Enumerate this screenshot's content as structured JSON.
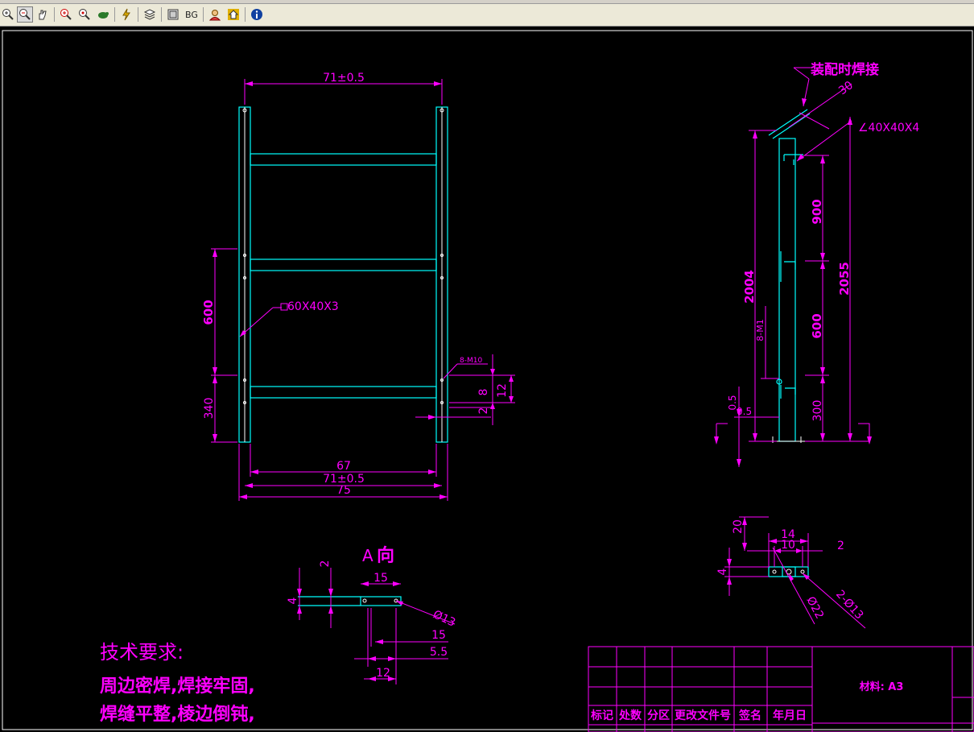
{
  "toolbar": {
    "buttons": [
      {
        "name": "zoom-in-icon",
        "glyph": "⊕"
      },
      {
        "name": "zoom-window-icon",
        "glyph": "🔍"
      },
      {
        "name": "pan-icon",
        "glyph": "✋"
      },
      {
        "name": "zoom-extents-icon",
        "glyph": "⊕"
      },
      {
        "name": "zoom-realtime-icon",
        "glyph": "🔍"
      },
      {
        "name": "orbit-icon",
        "glyph": "🐢"
      },
      {
        "name": "regen-icon",
        "glyph": "⚡"
      },
      {
        "name": "layers-icon",
        "glyph": "≣"
      },
      {
        "name": "layout-icon",
        "glyph": "▣"
      },
      {
        "name": "background-icon",
        "glyph": "BG"
      },
      {
        "name": "user-icon",
        "glyph": "☺"
      },
      {
        "name": "home-icon",
        "glyph": "⌂"
      },
      {
        "name": "info-icon",
        "glyph": "i"
      }
    ]
  },
  "drawing": {
    "front_view": {
      "top_width": "71±0.5",
      "tube_label": "60X40X3",
      "dim_600": "600",
      "dim_340": "340",
      "bolt_label": "8-M10",
      "dim_8": "8",
      "dim_12": "12",
      "dim_2": "2",
      "bottom_67": "67",
      "bottom_71": "71±0.5",
      "bottom_75": "75"
    },
    "side_view": {
      "weld_note": "装配时焊接",
      "angle_30": "30",
      "angle_label": "∠40X40X4",
      "dim_900": "900",
      "dim_2004": "2004",
      "dim_2055": "2055",
      "dim_600": "600",
      "dim_300": "300",
      "dim_8m1": "8-M1",
      "dim_05a": "0.5",
      "dim_05b": "0.5"
    },
    "view_a": {
      "title_a": "A",
      "title_dir": "向",
      "dim_2": "2",
      "dim_4": "4",
      "dim_15": "15",
      "dim_phi13": "Ø13",
      "dim_15b": "15",
      "dim_55": "5.5",
      "dim_12": "12"
    },
    "detail_view": {
      "dim_20": "20",
      "dim_14": "14",
      "dim_10": "10",
      "dim_2": "2",
      "dim_4": "4",
      "dim_phi22": "Ø22",
      "dim_2phi13": "2-Ø13"
    },
    "tech_req": {
      "title": "技术要求:",
      "line1": "周边密焊,焊接牢固,",
      "line2": "焊缝平整,棱边倒钝,"
    },
    "title_block": {
      "material": "材料: A3",
      "headers": [
        "标记",
        "处数",
        "分区",
        "更改文件号",
        "签名",
        "年月日"
      ]
    }
  }
}
